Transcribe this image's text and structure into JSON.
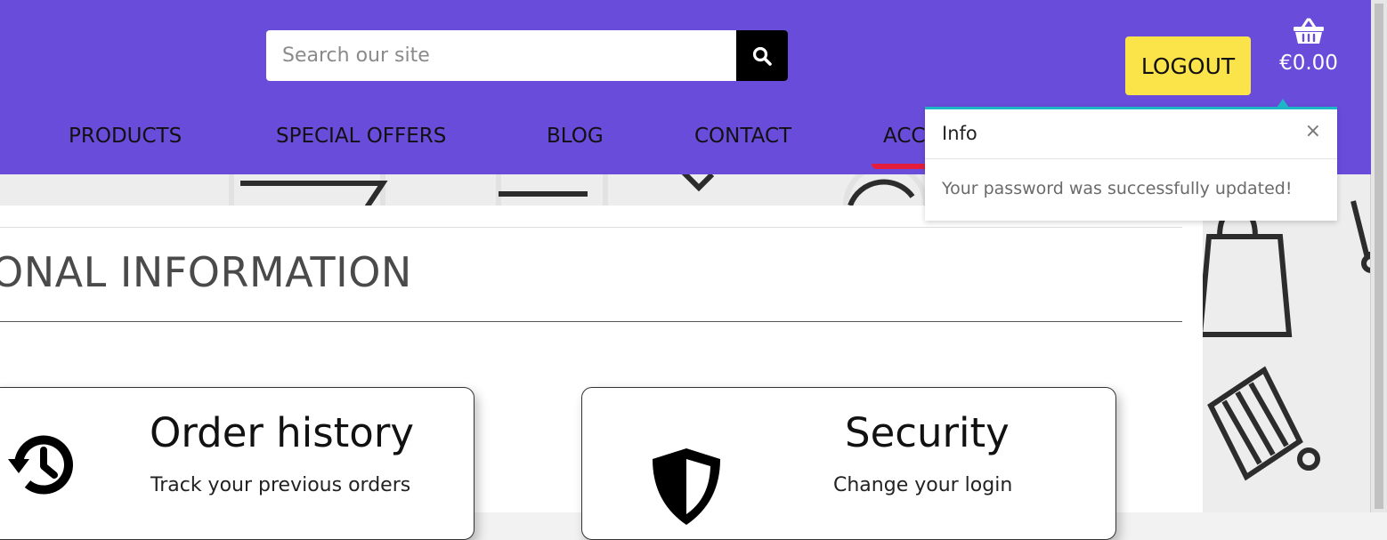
{
  "search": {
    "placeholder": "Search our site"
  },
  "header": {
    "logout_label": "LOGOUT",
    "cart_total": "€0.00"
  },
  "nav": {
    "items": [
      {
        "label": "PRODUCTS"
      },
      {
        "label": "SPECIAL OFFERS"
      },
      {
        "label": "BLOG"
      },
      {
        "label": "CONTACT"
      },
      {
        "label": "ACC"
      }
    ]
  },
  "main": {
    "section_title": "ONAL INFORMATION",
    "cards": [
      {
        "heading": "Order history",
        "description": "Track your previous orders"
      },
      {
        "heading": "Security",
        "description": "Change your login"
      }
    ]
  },
  "toast": {
    "title": "Info",
    "close": "×",
    "message": "Your password was successfully updated!"
  },
  "colors": {
    "header": "#6a4cdb",
    "logout": "#fbe34a",
    "toast_accent": "#1eb6c7",
    "active_nav": "#e41e3a"
  },
  "icons": [
    "search-icon",
    "basket-icon",
    "history-icon",
    "shield-icon",
    "close-icon"
  ]
}
